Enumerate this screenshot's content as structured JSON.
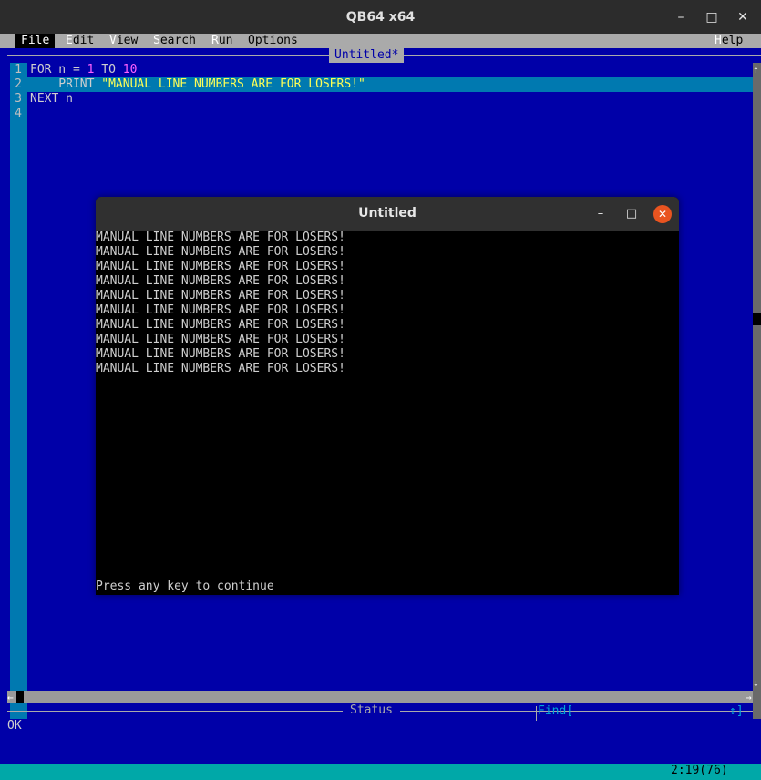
{
  "window": {
    "title": "QB64 x64",
    "minimize": "–",
    "maximize": "□",
    "close": "✕"
  },
  "menu": {
    "file": "File",
    "edit": {
      "hot": "E",
      "rest": "dit"
    },
    "view": {
      "hot": "V",
      "rest": "iew"
    },
    "search": {
      "hot": "S",
      "rest": "earch"
    },
    "run": {
      "hot": "R",
      "rest": "un"
    },
    "options": "Options",
    "help": {
      "hot": "H",
      "rest": "elp"
    }
  },
  "editor": {
    "tab_title": "Untitled*",
    "line_numbers": [
      "1",
      "2",
      "3",
      "4"
    ],
    "code": {
      "l1_for": "FOR n = ",
      "l1_start": "1",
      "l1_to": " TO ",
      "l1_end": "10",
      "l2_print": "    PRINT ",
      "l2_string": "\"MANUAL LINE NUMBERS ARE FOR LOSERS!\"",
      "l3": "NEXT n"
    }
  },
  "status": {
    "label": "Status",
    "find": "Find[",
    "find_arrows": "↕]",
    "message": "OK",
    "cursor": "2:19(76)"
  },
  "output_window": {
    "title": "Untitled",
    "lines": [
      "MANUAL LINE NUMBERS ARE FOR LOSERS!",
      "MANUAL LINE NUMBERS ARE FOR LOSERS!",
      "MANUAL LINE NUMBERS ARE FOR LOSERS!",
      "MANUAL LINE NUMBERS ARE FOR LOSERS!",
      "MANUAL LINE NUMBERS ARE FOR LOSERS!",
      "MANUAL LINE NUMBERS ARE FOR LOSERS!",
      "MANUAL LINE NUMBERS ARE FOR LOSERS!",
      "MANUAL LINE NUMBERS ARE FOR LOSERS!",
      "MANUAL LINE NUMBERS ARE FOR LOSERS!",
      "MANUAL LINE NUMBERS ARE FOR LOSERS!"
    ],
    "prompt": "Press any key to continue"
  },
  "colors": {
    "background": "#0000a8",
    "gutter": "#0079b0",
    "string": "#ffff55",
    "number": "#ff60ff",
    "close_button": "#e95420"
  }
}
